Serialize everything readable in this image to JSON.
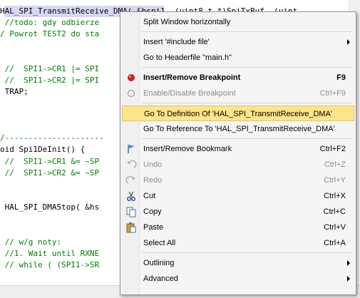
{
  "editor": {
    "lines": [
      {
        "text": "HAL_SPI_TransmitReceive_DMA( &hspi1, (uint8_t *)SpiTxBuf, (uint",
        "style": "code"
      },
      {
        "text": " //todo: gdy odbierze",
        "style": "comment"
      },
      {
        "text": "/ Powrot TEST2 do sta",
        "style": "comment"
      },
      {
        "text": "",
        "style": "code"
      },
      {
        "text": "",
        "style": "code"
      },
      {
        "text": " //  SPI1->CR1 |= SPI",
        "style": "comment"
      },
      {
        "text": " //  SPI1->CR2 |= SPI",
        "style": "comment"
      },
      {
        "text": " TRAP;",
        "style": "code"
      },
      {
        "text": "",
        "style": "code"
      },
      {
        "text": "",
        "style": "code"
      },
      {
        "text": "",
        "style": "code"
      },
      {
        "text": "/---------------------",
        "style": "comment"
      },
      {
        "text": "oid Spi1DeInit() {",
        "style": "code"
      },
      {
        "text": " //  SPI1->CR1 &= ~SP",
        "style": "comment"
      },
      {
        "text": " //  SPI1->CR2 &= ~SP",
        "style": "comment"
      },
      {
        "text": "",
        "style": "code"
      },
      {
        "text": "",
        "style": "code"
      },
      {
        "text": " HAL_SPI_DMAStop( &hs",
        "style": "code"
      },
      {
        "text": "",
        "style": "code"
      },
      {
        "text": "",
        "style": "code"
      },
      {
        "text": " // w/g noty:",
        "style": "comment"
      },
      {
        "text": " //1. Wait until RXNE",
        "style": "comment"
      },
      {
        "text": " // while ( (SPI1->SR",
        "style": "comment"
      }
    ]
  },
  "context_menu": {
    "items": [
      {
        "label": "Split Window horizontally",
        "shortcut": "",
        "icon": "",
        "state": "normal"
      },
      {
        "separator": true
      },
      {
        "label": "Insert '#include file'",
        "shortcut": "",
        "icon": "",
        "state": "normal",
        "submenu": true
      },
      {
        "label": "Go to Headerfile \"main.h\"",
        "shortcut": "",
        "icon": "",
        "state": "normal"
      },
      {
        "separator": true
      },
      {
        "label": "Insert/Remove Breakpoint",
        "shortcut": "F9",
        "icon": "breakpoint-icon",
        "state": "bold"
      },
      {
        "label": "Enable/Disable Breakpoint",
        "shortcut": "Ctrl+F9",
        "icon": "breakpoint-outline-icon",
        "state": "disabled"
      },
      {
        "separator": true
      },
      {
        "label": "Go To Definition Of 'HAL_SPI_TransmitReceive_DMA'",
        "shortcut": "",
        "icon": "",
        "state": "highlight"
      },
      {
        "label": "Go To Reference To 'HAL_SPI_TransmitReceive_DMA'",
        "shortcut": "",
        "icon": "",
        "state": "normal"
      },
      {
        "separator": true
      },
      {
        "label": "Insert/Remove Bookmark",
        "shortcut": "Ctrl+F2",
        "icon": "bookmark-flag-icon",
        "state": "normal"
      },
      {
        "label": "Undo",
        "shortcut": "Ctrl+Z",
        "icon": "undo-icon",
        "state": "disabled"
      },
      {
        "label": "Redo",
        "shortcut": "Ctrl+Y",
        "icon": "redo-icon",
        "state": "disabled"
      },
      {
        "label": "Cut",
        "shortcut": "Ctrl+X",
        "icon": "scissors-icon",
        "state": "normal"
      },
      {
        "label": "Copy",
        "shortcut": "Ctrl+C",
        "icon": "copy-icon",
        "state": "normal"
      },
      {
        "label": "Paste",
        "shortcut": "Ctrl+V",
        "icon": "paste-icon",
        "state": "normal"
      },
      {
        "label": "Select All",
        "shortcut": "Ctrl+A",
        "icon": "",
        "state": "normal"
      },
      {
        "separator": true
      },
      {
        "label": "Outlining",
        "shortcut": "",
        "icon": "",
        "state": "normal",
        "submenu": true
      },
      {
        "label": "Advanced",
        "shortcut": "",
        "icon": "",
        "state": "normal",
        "submenu": true
      }
    ]
  },
  "colors": {
    "comment": "#008000",
    "highlight_bg": "#fbe58a",
    "breakpoint": "#d02020"
  }
}
